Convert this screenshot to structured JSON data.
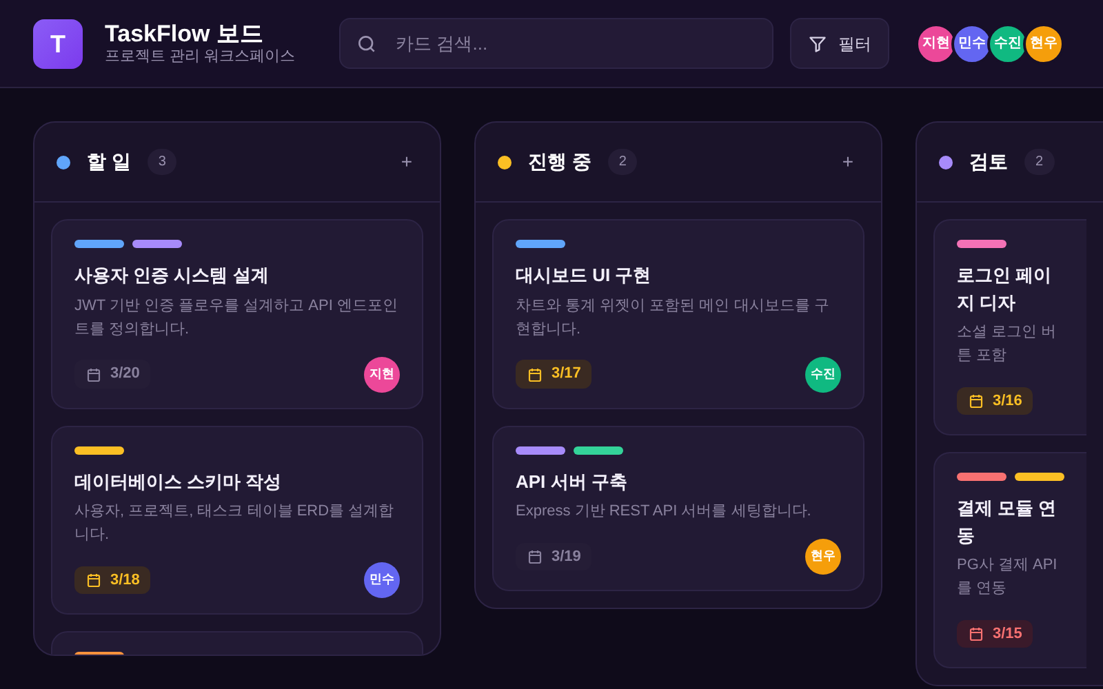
{
  "app": {
    "logo": "T",
    "title": "TaskFlow 보드",
    "subtitle": "프로젝트 관리 워크스페이스"
  },
  "search": {
    "placeholder": "카드 검색..."
  },
  "filter_button": {
    "label": "필터"
  },
  "members": [
    {
      "name": "지현",
      "color": "#ec4899"
    },
    {
      "name": "민수",
      "color": "#6366f1"
    },
    {
      "name": "수진",
      "color": "#10b981"
    },
    {
      "name": "현우",
      "color": "#f59e0b"
    }
  ],
  "columns": [
    {
      "title": "할 일",
      "count": "3",
      "color": "#60a5fa",
      "add": "+",
      "cards": [
        {
          "labels": [
            {
              "color": "#60a5fa"
            },
            {
              "color": "#a78bfa"
            }
          ],
          "title": "사용자 인증 시스템 설계",
          "description": "JWT 기반 인증 플로우를 설계하고 API 엔드포인트를 정의합니다.",
          "due": "3/20",
          "due_soon": false,
          "overdue": false,
          "assignee": {
            "name": "지현",
            "color": "#ec4899"
          }
        },
        {
          "labels": [
            {
              "color": "#fbbf24"
            }
          ],
          "title": "데이터베이스 스키마 작성",
          "description": "사용자, 프로젝트, 태스크 테이블 ERD를 설계합니다.",
          "due": "3/18",
          "due_soon": true,
          "overdue": false,
          "assignee": {
            "name": "민수",
            "color": "#6366f1"
          }
        },
        {
          "labels": [
            {
              "color": "#fb923c"
            }
          ]
        }
      ]
    },
    {
      "title": "진행 중",
      "count": "2",
      "color": "#fbbf24",
      "add": "+",
      "cards": [
        {
          "labels": [
            {
              "color": "#60a5fa"
            }
          ],
          "title": "대시보드 UI 구현",
          "description": "차트와 통계 위젯이 포함된 메인 대시보드를 구현합니다.",
          "due": "3/17",
          "due_soon": true,
          "overdue": false,
          "assignee": {
            "name": "수진",
            "color": "#10b981"
          }
        },
        {
          "labels": [
            {
              "color": "#a78bfa"
            },
            {
              "color": "#34d399"
            }
          ],
          "title": "API 서버 구축",
          "description": "Express 기반 REST API 서버를 세팅합니다.",
          "due": "3/19",
          "due_soon": false,
          "overdue": false,
          "assignee": {
            "name": "현우",
            "color": "#f59e0b"
          }
        }
      ]
    },
    {
      "title": "검토",
      "count": "2",
      "color": "#a78bfa",
      "cards": [
        {
          "labels": [
            {
              "color": "#f472b6"
            }
          ],
          "title": "로그인 페이지 디자",
          "description": "소셜 로그인 버튼 포함",
          "due": "3/16",
          "due_soon": true,
          "overdue": false
        },
        {
          "labels": [
            {
              "color": "#f87171"
            },
            {
              "color": "#fbbf24"
            }
          ],
          "title": "결제 모듈 연동",
          "description": "PG사 결제 API를 연동",
          "due": "3/15",
          "overdue": true
        }
      ]
    }
  ]
}
